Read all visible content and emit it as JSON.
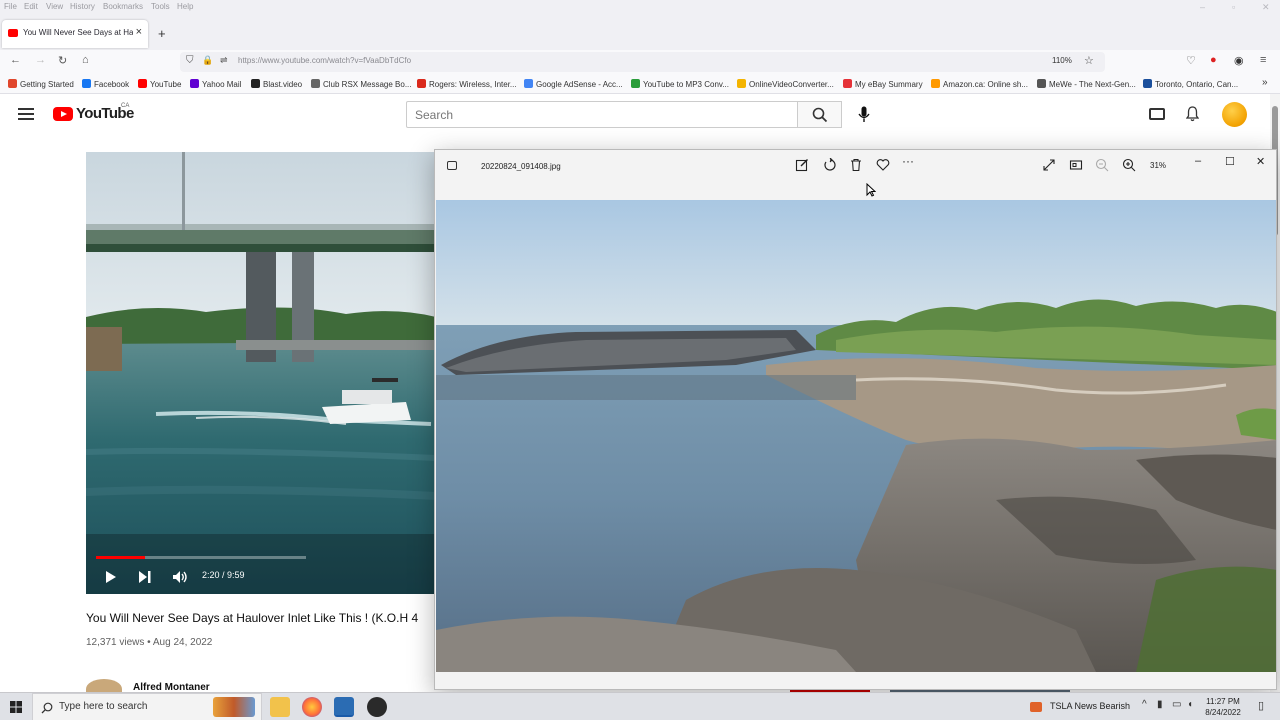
{
  "menubar": {
    "items": [
      "File",
      "Edit",
      "View",
      "History",
      "Bookmarks",
      "Tools",
      "Help"
    ]
  },
  "tab": {
    "title": "You Will Never See Days at Hau",
    "close": "×"
  },
  "newtab": "+",
  "navbar": {
    "url": "https://www.youtube.com/watch?v=fVaaDbTdCfo",
    "zoom": "110%"
  },
  "bookmarks": [
    {
      "label": "Getting Started",
      "color": "#e0462c"
    },
    {
      "label": "Facebook",
      "color": "#1877f2"
    },
    {
      "label": "YouTube",
      "color": "#ff0000"
    },
    {
      "label": "Yahoo Mail",
      "color": "#6001d2"
    },
    {
      "label": "Blast.video",
      "color": "#222222"
    },
    {
      "label": "Club RSX Message Bo...",
      "color": "#666666"
    },
    {
      "label": "Rogers: Wireless, Inter...",
      "color": "#da291c"
    },
    {
      "label": "Google AdSense - Acc...",
      "color": "#4285f4"
    },
    {
      "label": "YouTube to MP3 Conv...",
      "color": "#2a9d3a"
    },
    {
      "label": "OnlineVideoConverter...",
      "color": "#f4b400"
    },
    {
      "label": "My eBay Summary",
      "color": "#e53238"
    },
    {
      "label": "Amazon.ca: Online sh...",
      "color": "#ff9900"
    },
    {
      "label": "MeWe - The Next-Gen...",
      "color": "#555555"
    },
    {
      "label": "Toronto, Ontario, Can...",
      "color": "#1b4f9c"
    }
  ],
  "youtube": {
    "logo": "YouTube",
    "region": "CA",
    "search_placeholder": "Search",
    "player": {
      "time": "2:20 / 9:59",
      "progress": 0.234
    },
    "video_title": "You Will Never See Days at Haulover Inlet Like This ! (K.O.H 4",
    "video_meta": "12,371 views • Aug 24, 2022",
    "channel": "Alfred Montaner"
  },
  "photos": {
    "filename": "20220824_091408.jpg",
    "zoom": "31%",
    "controls": [
      "edit-icon",
      "rotate-icon",
      "delete-icon",
      "favorite-icon",
      "more-icon",
      "fullscreen-icon",
      "slideshow-icon",
      "zoom-out-icon",
      "zoom-in-icon"
    ],
    "min": "–",
    "max": "☐",
    "close": "✕"
  },
  "taskbar": {
    "search_placeholder": "Type here to search",
    "news": "TSLA  News Bearish",
    "time": "11:27 PM",
    "date": "8/24/2022"
  }
}
